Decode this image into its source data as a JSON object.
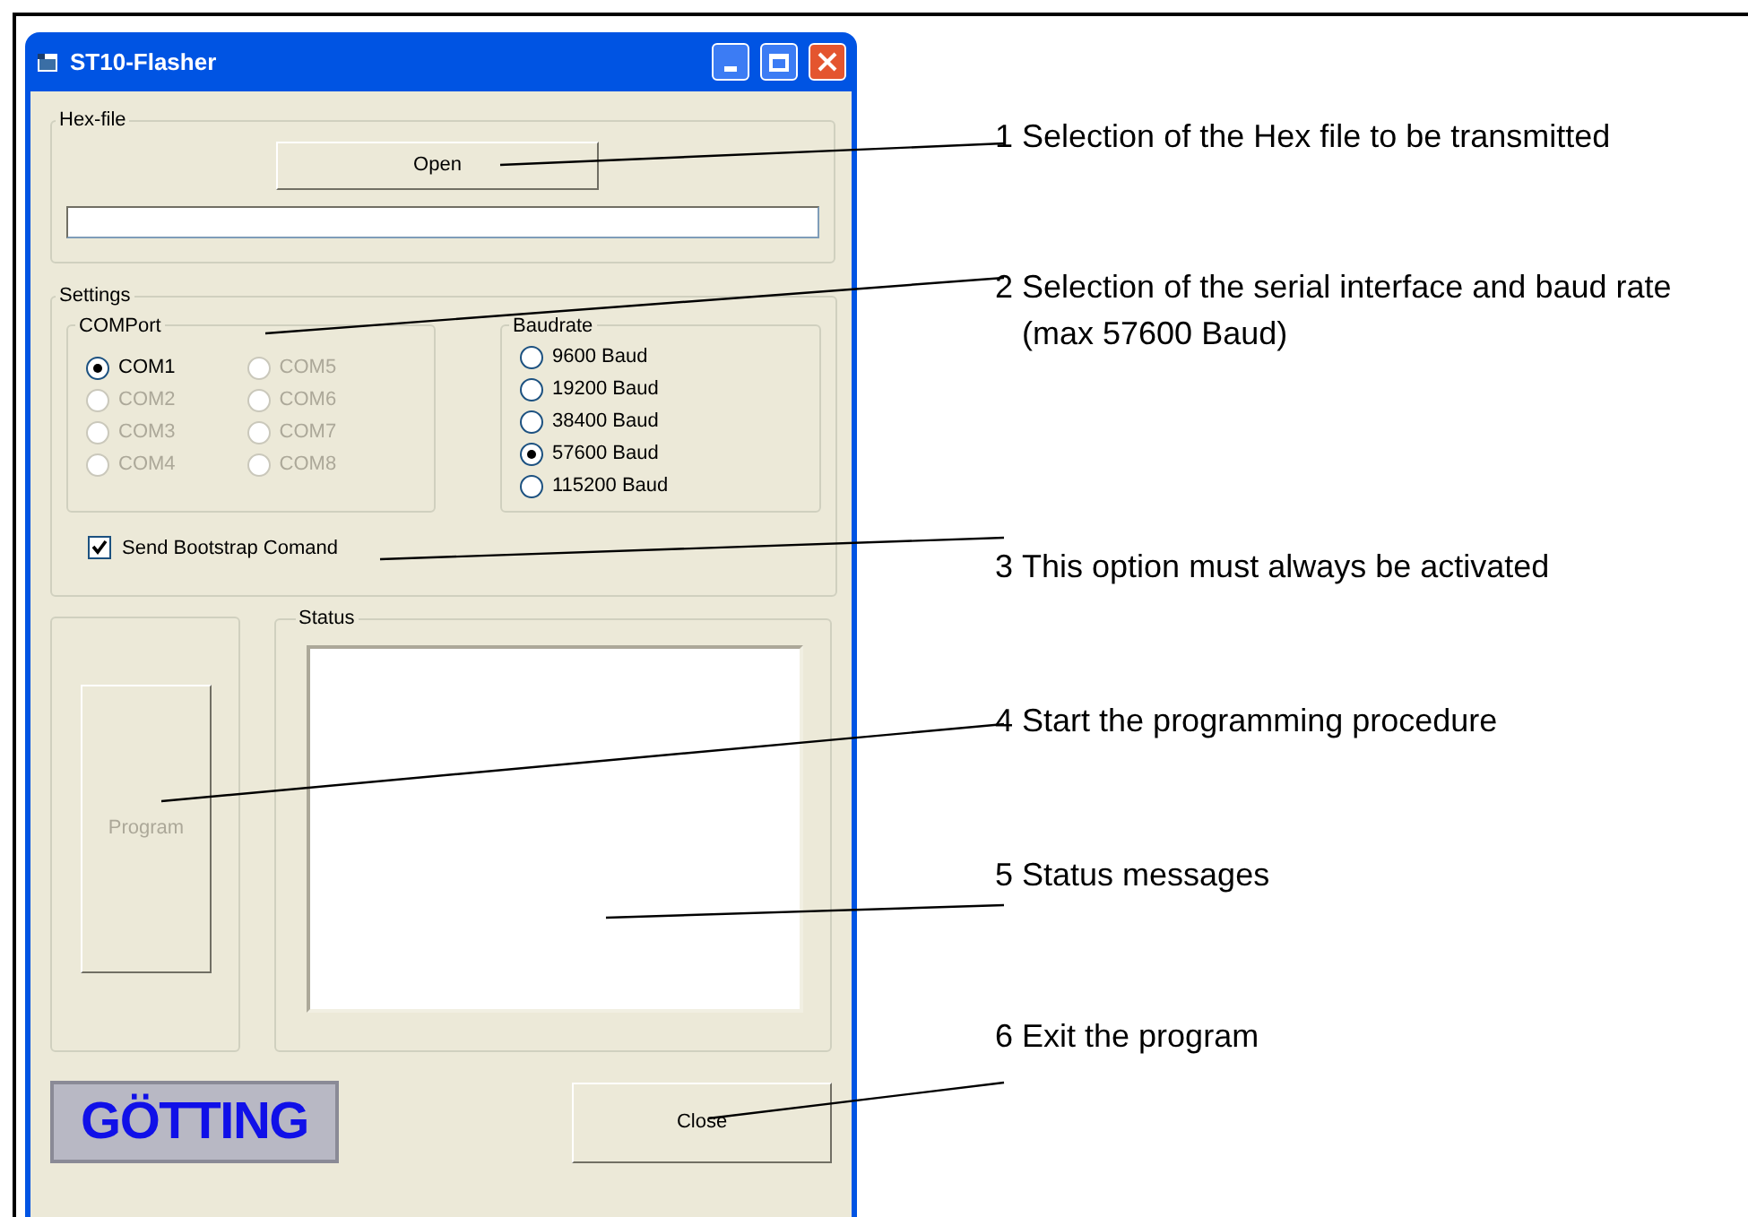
{
  "window": {
    "title": "ST10-Flasher"
  },
  "hex_file": {
    "label": "Hex-file",
    "open_button": "Open"
  },
  "settings": {
    "label": "Settings",
    "comport": {
      "label": "COMPort",
      "options": [
        {
          "label": "COM1",
          "selected": true,
          "disabled": false
        },
        {
          "label": "COM2",
          "selected": false,
          "disabled": true
        },
        {
          "label": "COM3",
          "selected": false,
          "disabled": true
        },
        {
          "label": "COM4",
          "selected": false,
          "disabled": true
        },
        {
          "label": "COM5",
          "selected": false,
          "disabled": true
        },
        {
          "label": "COM6",
          "selected": false,
          "disabled": true
        },
        {
          "label": "COM7",
          "selected": false,
          "disabled": true
        },
        {
          "label": "COM8",
          "selected": false,
          "disabled": true
        }
      ]
    },
    "baudrate": {
      "label": "Baudrate",
      "options": [
        {
          "label": "9600 Baud",
          "selected": false
        },
        {
          "label": "19200 Baud",
          "selected": false
        },
        {
          "label": "38400 Baud",
          "selected": false
        },
        {
          "label": "57600 Baud",
          "selected": true
        },
        {
          "label": "115200 Baud",
          "selected": false
        }
      ]
    },
    "bootstrap": {
      "label": "Send Bootstrap Comand",
      "checked": true
    }
  },
  "program_button": {
    "label": "Program",
    "disabled": true
  },
  "status": {
    "label": "Status"
  },
  "logo": "GÖTTING",
  "close_button": "Close",
  "annotations": [
    {
      "number": "1",
      "text": "Selection of the Hex file to be transmitted"
    },
    {
      "number": "2",
      "text": "Selection of the serial interface and baud rate (max 57600 Baud)"
    },
    {
      "number": "3",
      "text": "This option must always be activated"
    },
    {
      "number": "4",
      "text": "Start the programming procedure"
    },
    {
      "number": "5",
      "text": "Status messages"
    },
    {
      "number": "6",
      "text": "Exit the program"
    }
  ]
}
